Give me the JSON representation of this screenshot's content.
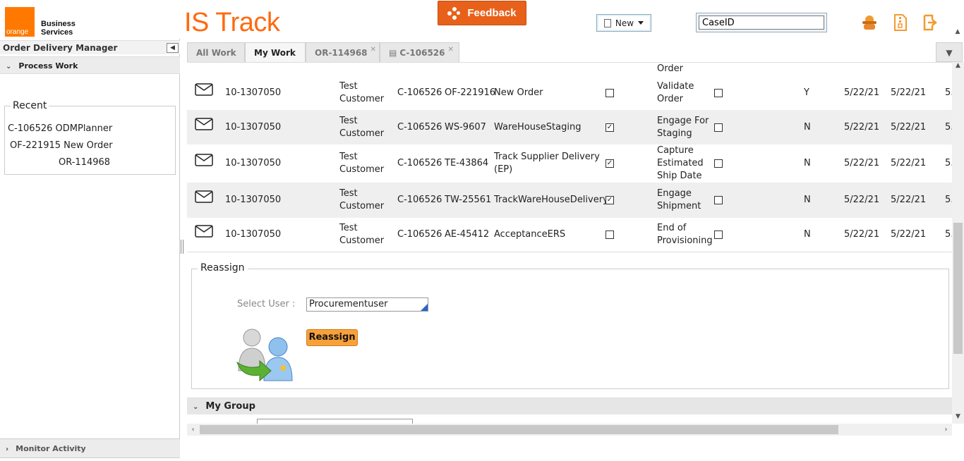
{
  "header": {
    "logo_word": "orange",
    "logo_line1": "Business",
    "logo_line2": "Services",
    "app_title": "IS Track",
    "feedback_label": "Feedback",
    "new_label": "New",
    "caseid_value": "CaseID"
  },
  "left_panel": {
    "title": "Order Delivery Manager",
    "process_work": "Process Work",
    "recent_label": "Recent",
    "recent_items": [
      "C-106526 ODMPlanner",
      "OF-221915 New Order",
      "OR-114968"
    ],
    "monitor_activity": "Monitor Activity"
  },
  "tabs": [
    {
      "label": "All Work"
    },
    {
      "label": "My Work"
    },
    {
      "label": "OR-114968"
    },
    {
      "label": "C-106526"
    }
  ],
  "table": {
    "top_partial": "Order",
    "rows": [
      {
        "id": "10-1307050",
        "customer_1": "Test",
        "customer_2": "Customer",
        "case": "C-106526",
        "task_id": "OF-221916",
        "task_name_1": "New Order",
        "task_name_2": "",
        "checked": false,
        "step_1": "Validate",
        "step_2": "Order",
        "step_3": "",
        "flag": "Y",
        "date1": "5/22/21",
        "date2": "5/22/21",
        "date3": "5."
      },
      {
        "id": "10-1307050",
        "customer_1": "Test",
        "customer_2": "Customer",
        "case": "C-106526",
        "task_id": "WS-9607",
        "task_name_1": "WareHouseStaging",
        "task_name_2": "",
        "checked": true,
        "step_1": "Engage For",
        "step_2": "Staging",
        "step_3": "",
        "flag": "N",
        "date1": "5/22/21",
        "date2": "5/22/21",
        "date3": "5."
      },
      {
        "id": "10-1307050",
        "customer_1": "Test",
        "customer_2": "Customer",
        "case": "C-106526",
        "task_id": "TE-43864",
        "task_name_1": "Track Supplier Delivery",
        "task_name_2": "(EP)",
        "checked": true,
        "step_1": "Capture",
        "step_2": "Estimated",
        "step_3": "Ship Date",
        "flag": "N",
        "date1": "5/22/21",
        "date2": "5/22/21",
        "date3": "5."
      },
      {
        "id": "10-1307050",
        "customer_1": "Test",
        "customer_2": "Customer",
        "case": "C-106526",
        "task_id": "TW-25561",
        "task_name_1": "TrackWareHouseDelivery",
        "task_name_2": "",
        "checked": true,
        "step_1": "Engage",
        "step_2": "Shipment",
        "step_3": "",
        "flag": "N",
        "date1": "5/22/21",
        "date2": "5/22/21",
        "date3": "5."
      },
      {
        "id": "10-1307050",
        "customer_1": "Test",
        "customer_2": "Customer",
        "case": "C-106526",
        "task_id": "AE-45412",
        "task_name_1": "AcceptanceERS",
        "task_name_2": "",
        "checked": false,
        "step_1": "End of",
        "step_2": "Provisioning",
        "step_3": "",
        "flag": "N",
        "date1": "5/22/21",
        "date2": "5/22/21",
        "date3": "5."
      }
    ]
  },
  "reassign": {
    "legend": "Reassign",
    "select_user_label": "Select User :",
    "select_user_value": "Procurementuser",
    "button_label": "Reassign"
  },
  "my_group": {
    "label": "My Group"
  },
  "colors": {
    "brand_orange": "#ff7900",
    "title_orange": "#ff6a0e",
    "reassign_button": "#f8a13a"
  }
}
